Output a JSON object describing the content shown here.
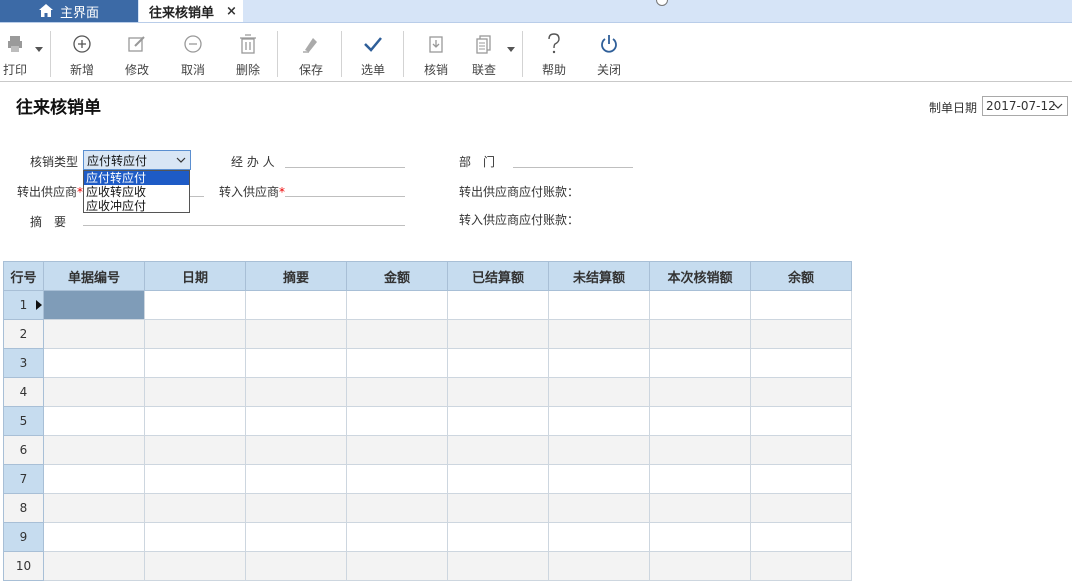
{
  "tabs": [
    {
      "label": "主界面",
      "icon": "home-icon"
    },
    {
      "label": "往来核销单",
      "close": "×"
    }
  ],
  "toolbar": {
    "print": "打印",
    "add": "新增",
    "edit": "修改",
    "cancel": "取消",
    "delete": "删除",
    "save": "保存",
    "select": "选单",
    "verify": "核销",
    "query": "联查",
    "help": "帮助",
    "close": "关闭"
  },
  "form": {
    "title": "往来核销单",
    "date_label": "制单日期",
    "date_value": "2017-07-12",
    "type_label": "核销类型",
    "type_value": "应付转应付",
    "type_options": [
      "应付转应付",
      "应收转应收",
      "应收冲应付"
    ],
    "handler_label": "经 办 人",
    "dept_label": "部　门",
    "out_supplier_label": "转出供应商",
    "in_supplier_label": "转入供应商",
    "required_mark": "*",
    "out_account_label": "转出供应商应付账款：",
    "in_account_label": "转入供应商应付账款：",
    "summary_label": "摘　要"
  },
  "grid": {
    "columns": [
      "行号",
      "单据编号",
      "日期",
      "摘要",
      "金额",
      "已结算额",
      "未结算额",
      "本次核销额",
      "余额"
    ],
    "rows": [
      "1",
      "2",
      "3",
      "4",
      "5",
      "6",
      "7",
      "8",
      "9",
      "10"
    ]
  },
  "colors": {
    "tab_active_bg": "#3c6aa6",
    "header_bg": "#c6dcef",
    "selected_cell": "#7f9cb8",
    "dropdown_selected": "#1e5bc6"
  }
}
